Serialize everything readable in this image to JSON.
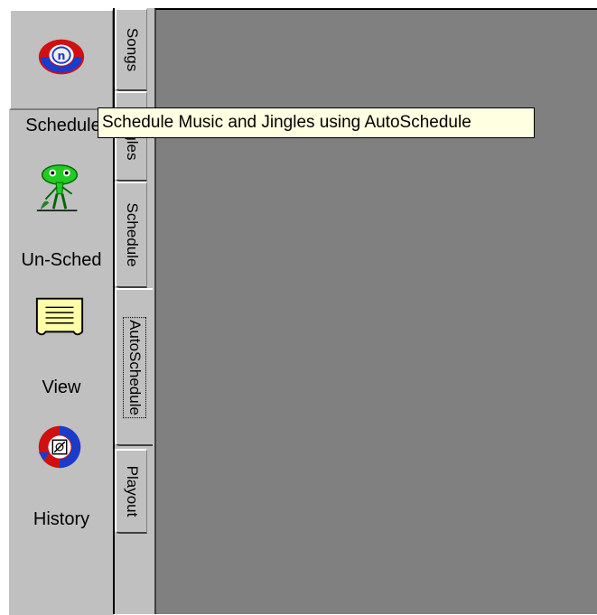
{
  "toolbar": {
    "buttons": [
      {
        "label": "Schedule",
        "icon": "schedule-logo-icon"
      },
      {
        "label": "Un-Sched",
        "icon": "alien-creature-icon"
      },
      {
        "label": "View",
        "icon": "note-paper-icon"
      },
      {
        "label": "History",
        "icon": "history-logo-icon"
      }
    ]
  },
  "tabs": [
    {
      "label": "Songs"
    },
    {
      "label": "Jingles"
    },
    {
      "label": "Schedule"
    },
    {
      "label": "AutoSchedule",
      "active": true
    },
    {
      "label": "Playout"
    }
  ],
  "tooltip": {
    "text": "Schedule Music and Jingles using AutoSchedule"
  },
  "colors": {
    "toolbar_bg": "#c0c0c0",
    "workarea_bg": "#808080",
    "tooltip_bg": "#ffffe1",
    "logo_red": "#d01010",
    "logo_blue": "#1a3ccc",
    "alien_green": "#22cc22"
  }
}
